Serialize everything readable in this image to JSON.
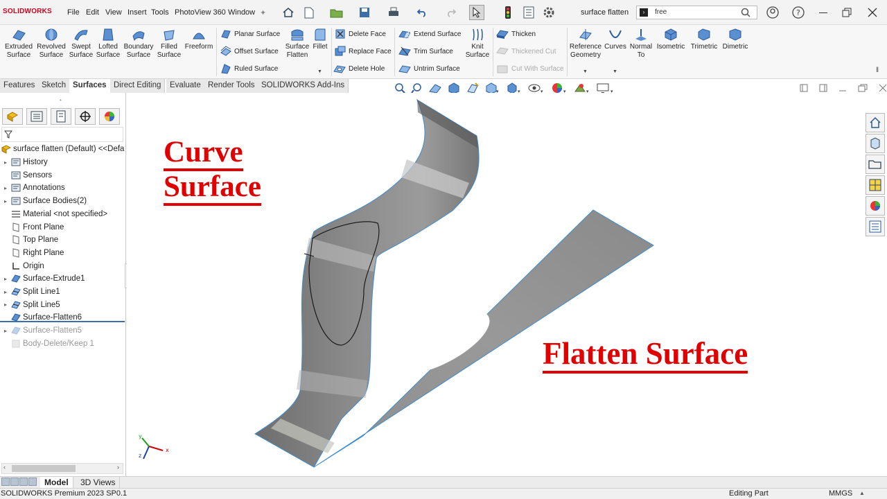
{
  "app": {
    "logo_text": "SOLIDWORKS",
    "menus": [
      "File",
      "Edit",
      "View",
      "Insert",
      "Tools",
      "PhotoView 360",
      "Window"
    ],
    "doc_title": "surface flatten",
    "search_value": "free"
  },
  "ribbon": {
    "large_buttons": [
      {
        "label1": "Extruded",
        "label2": "Surface",
        "icon": "extruded-surface-icon"
      },
      {
        "label1": "Revolved",
        "label2": "Surface",
        "icon": "revolved-surface-icon"
      },
      {
        "label1": "Swept",
        "label2": "Surface",
        "icon": "swept-surface-icon"
      },
      {
        "label1": "Lofted",
        "label2": "Surface",
        "icon": "lofted-surface-icon"
      },
      {
        "label1": "Boundary",
        "label2": "Surface",
        "icon": "boundary-surface-icon"
      },
      {
        "label1": "Filled",
        "label2": "Surface",
        "icon": "filled-surface-icon"
      },
      {
        "label1": "Freeform",
        "label2": "",
        "icon": "freeform-icon"
      }
    ],
    "group1": [
      "Planar Surface",
      "Offset Surface",
      "Ruled Surface"
    ],
    "flatten": {
      "label1": "Surface",
      "label2": "Flatten"
    },
    "fillet": "Fillet",
    "group2": [
      "Delete Face",
      "Replace Face",
      "Delete Hole"
    ],
    "group3": [
      "Extend Surface",
      "Trim Surface",
      "Untrim Surface"
    ],
    "knit": {
      "label1": "Knit",
      "label2": "Surface"
    },
    "group4": [
      "Thicken",
      "Thickened Cut",
      "Cut With Surface"
    ],
    "views": [
      {
        "label1": "Reference",
        "label2": "Geometry"
      },
      {
        "label1": "Curves",
        "label2": ""
      },
      {
        "label1": "Normal",
        "label2": "To"
      },
      {
        "label1": "Isometric",
        "label2": ""
      },
      {
        "label1": "Trimetric",
        "label2": ""
      },
      {
        "label1": "Dimetric",
        "label2": ""
      }
    ]
  },
  "tabs": [
    "Features",
    "Sketch",
    "Surfaces",
    "Direct Editing",
    "Evaluate",
    "Render Tools",
    "SOLIDWORKS Add-Ins"
  ],
  "tree": {
    "root": "surface flatten (Default) <<Defa",
    "items": [
      {
        "label": "History",
        "arrow": true,
        "dim": false
      },
      {
        "label": "Sensors",
        "arrow": false,
        "dim": false
      },
      {
        "label": "Annotations",
        "arrow": true,
        "dim": false
      },
      {
        "label": "Surface Bodies(2)",
        "arrow": true,
        "dim": false
      },
      {
        "label": "Material <not specified>",
        "arrow": false,
        "dim": false
      },
      {
        "label": "Front Plane",
        "arrow": false,
        "dim": false
      },
      {
        "label": "Top Plane",
        "arrow": false,
        "dim": false
      },
      {
        "label": "Right Plane",
        "arrow": false,
        "dim": false
      },
      {
        "label": "Origin",
        "arrow": false,
        "dim": false
      },
      {
        "label": "Surface-Extrude1",
        "arrow": true,
        "dim": false
      },
      {
        "label": "Split Line1",
        "arrow": true,
        "dim": false
      },
      {
        "label": "Split Line5",
        "arrow": true,
        "dim": false
      },
      {
        "label": "Surface-Flatten6",
        "arrow": false,
        "dim": false
      },
      {
        "label": "Surface-Flatten5",
        "arrow": true,
        "dim": true
      },
      {
        "label": "Body-Delete/Keep 1",
        "arrow": false,
        "dim": true
      }
    ]
  },
  "overlay": {
    "curve_line1": "Curve",
    "curve_line2": "Surface",
    "flatten_label": "Flatten Surface",
    "label_color": "#e00000"
  },
  "bottom_tabs": [
    "Model",
    "3D Views"
  ],
  "status": {
    "product": "SOLIDWORKS Premium 2023 SP0.1",
    "mode": "Editing Part",
    "units": "MMGS"
  }
}
